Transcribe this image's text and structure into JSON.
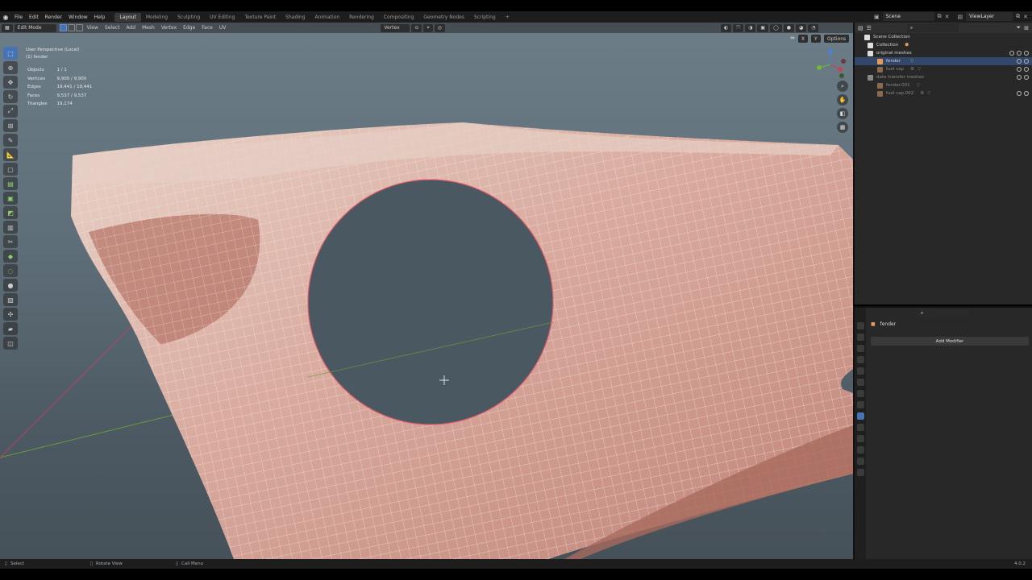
{
  "menubar": {
    "menus": [
      "File",
      "Edit",
      "Render",
      "Window",
      "Help"
    ],
    "workspaces": [
      "Layout",
      "Modeling",
      "Sculpting",
      "UV Editing",
      "Texture Paint",
      "Shading",
      "Animation",
      "Rendering",
      "Compositing",
      "Geometry Nodes",
      "Scripting"
    ],
    "active_workspace": "Layout",
    "add_tab": "+",
    "scene": "Scene",
    "view_layer": "ViewLayer"
  },
  "viewport": {
    "mode": "Edit Mode",
    "menus": [
      "View",
      "Select",
      "Add",
      "Mesh",
      "Vertex",
      "Edge",
      "Face",
      "UV"
    ],
    "pivot": "Vertex",
    "axes": [
      "X",
      "Y",
      "Z"
    ],
    "options": "Options",
    "view_name": "User Perspective (Local)",
    "object_name": "(1) fender",
    "stats": [
      {
        "label": "Objects",
        "value": "1 / 1"
      },
      {
        "label": "Vertices",
        "value": "9,900 / 9,900"
      },
      {
        "label": "Edges",
        "value": "19,441 / 19,441"
      },
      {
        "label": "Faces",
        "value": "9,537 / 9,537"
      },
      {
        "label": "Triangles",
        "value": "19,174"
      }
    ]
  },
  "outliner": {
    "rows": [
      {
        "name": "Scene Collection",
        "indent": 0,
        "selected": false,
        "dim": false
      },
      {
        "name": "Collection",
        "indent": 1,
        "selected": false,
        "dim": false
      },
      {
        "name": "original meshes",
        "indent": 1,
        "selected": false,
        "dim": false
      },
      {
        "name": "fender",
        "indent": 2,
        "selected": true,
        "dim": false
      },
      {
        "name": "fuel cap",
        "indent": 2,
        "selected": false,
        "dim": true
      },
      {
        "name": "data transfer meshes",
        "indent": 1,
        "selected": false,
        "dim": true
      },
      {
        "name": "fender.001",
        "indent": 2,
        "selected": false,
        "dim": true
      },
      {
        "name": "fuel cap.002",
        "indent": 2,
        "selected": false,
        "dim": true
      }
    ]
  },
  "properties": {
    "object_name": "fender",
    "add_modifier": "Add Modifier"
  },
  "statusbar": {
    "select": "Select",
    "rotate": "Rotate View",
    "call_menu": "Call Menu",
    "version": "4.0.2"
  },
  "colors": {
    "accent": "#4772b3",
    "mesh": "#c8938a",
    "wire": "#f2e6e0",
    "hole_edge": "#e05a6a",
    "x_axis": "#c8425c",
    "y_axis": "#6a9a3a"
  }
}
